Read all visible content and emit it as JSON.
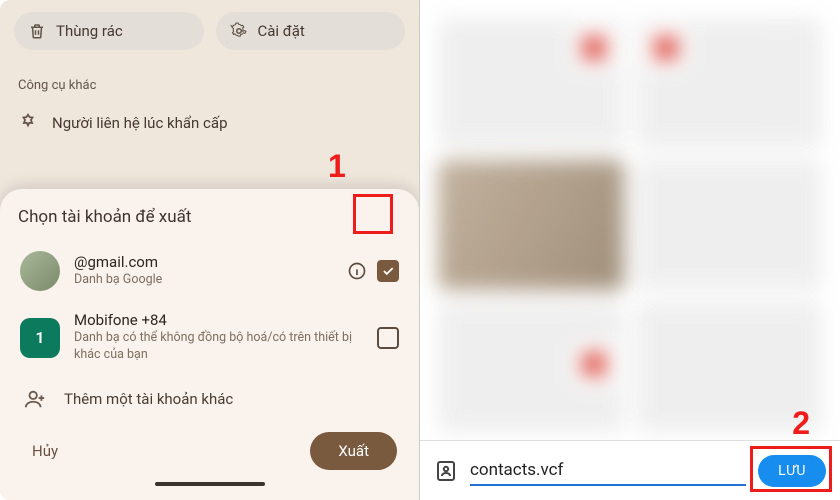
{
  "left": {
    "pill_trash": "Thùng rác",
    "pill_settings": "Cài đặt",
    "section_other_tools": "Công cụ khác",
    "emergency_contact": "Người liên hệ lúc khẩn cấp"
  },
  "sheet": {
    "title": "Chọn tài khoản để xuất",
    "accounts": [
      {
        "email": "            @gmail.com",
        "sub": "Danh bạ Google",
        "checked": true
      },
      {
        "email": "Mobifone +84",
        "sub": "Danh bạ có thể không đồng bộ hoá/có trên thiết bị khác của bạn",
        "sim": "1",
        "checked": false
      }
    ],
    "add_account": "Thêm một tài khoản khác",
    "cancel": "Hủy",
    "export": "Xuất"
  },
  "right": {
    "filename": "contacts.vcf",
    "save": "LƯU"
  },
  "annotations": {
    "step1": "1",
    "step2": "2"
  }
}
